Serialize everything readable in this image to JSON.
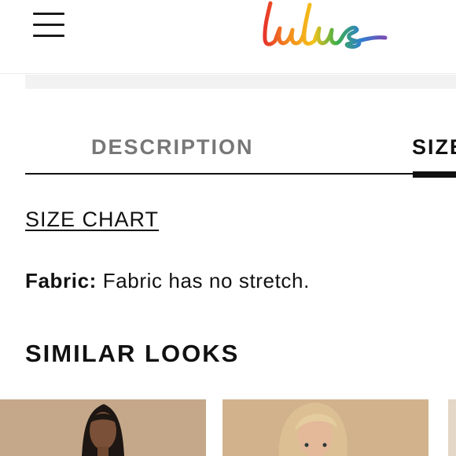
{
  "header": {
    "menu_icon": "hamburger-menu-icon",
    "logo_text": "Lulus",
    "logo_colors": [
      "#e8352a",
      "#f28c1e",
      "#f5c21b",
      "#3cae4a",
      "#2f7fd0",
      "#7b4bb3"
    ]
  },
  "tabs": [
    {
      "label": "DESCRIPTION",
      "active": false
    },
    {
      "label": "SIZE",
      "active": true
    }
  ],
  "size_chart_link": "SIZE CHART",
  "fabric": {
    "label": "Fabric:",
    "value": "Fabric has no stretch."
  },
  "similar_looks": {
    "title": "SIMILAR LOOKS",
    "items": [
      {
        "image": "model-dark-hair-photo"
      },
      {
        "image": "model-blonde-hair-photo"
      },
      {
        "image": "partial-product-photo"
      }
    ]
  }
}
